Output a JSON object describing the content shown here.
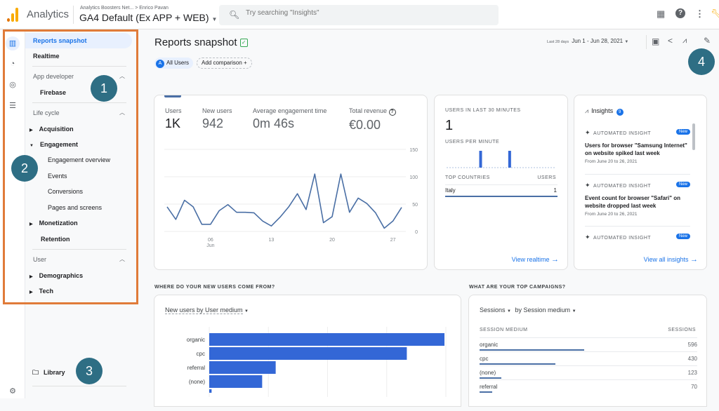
{
  "header": {
    "app_name": "Analytics",
    "breadcrumb_account": "Analytics Boosters Net...",
    "breadcrumb_sep": ">",
    "breadcrumb_user": "Enrico Pavan",
    "property": "GA4 Default (Ex APP + WEB)",
    "search_placeholder": "Try searching \"Insights\"",
    "logo_colors": [
      "#f9ab00",
      "#e37400"
    ]
  },
  "sidebar": {
    "items": [
      {
        "label": "Reports snapshot",
        "selected": true
      },
      {
        "label": "Realtime"
      },
      {
        "label": "App developer",
        "group": true
      },
      {
        "label": "Firebase"
      },
      {
        "label": "Life cycle",
        "group": true
      },
      {
        "label": "Acquisition"
      },
      {
        "label": "Engagement"
      },
      {
        "label": "Engagement overview"
      },
      {
        "label": "Events"
      },
      {
        "label": "Conversions"
      },
      {
        "label": "Pages and screens"
      },
      {
        "label": "Monetization"
      },
      {
        "label": "Retention"
      },
      {
        "label": "User",
        "group": true
      },
      {
        "label": "Demographics"
      },
      {
        "label": "Tech"
      }
    ],
    "library": "Library"
  },
  "annotations": [
    "1",
    "2",
    "3",
    "4"
  ],
  "page": {
    "title": "Reports snapshot",
    "date_prefix": "Last 28 days",
    "date_range": "Jun 1 - Jun 28, 2021",
    "segment_letter": "A",
    "segment": "All Users",
    "add_comparison": "Add comparison",
    "accent": "#1a73e8"
  },
  "kpis": [
    {
      "label": "Users",
      "value": "1K"
    },
    {
      "label": "New users",
      "value": "942"
    },
    {
      "label": "Average engagement time",
      "value": "0m 46s"
    },
    {
      "label": "Total revenue",
      "value": "€0.00"
    }
  ],
  "realtime": {
    "title": "USERS IN LAST 30 MINUTES",
    "value": "1",
    "per_minute_label": "USERS PER MINUTE",
    "countries_header": "TOP COUNTRIES",
    "users_header": "USERS",
    "rows": [
      {
        "country": "Italy",
        "users": "1"
      }
    ],
    "link": "View realtime"
  },
  "insights": {
    "title": "Insights",
    "count": "9",
    "items": [
      {
        "type": "AUTOMATED INSIGHT",
        "badge": "New",
        "text": "Users for browser \"Samsung Internet\" on website spiked last week",
        "date": "From June 20 to 26, 2021"
      },
      {
        "type": "AUTOMATED INSIGHT",
        "badge": "New",
        "text": "Event count for browser \"Safari\" on website dropped last week",
        "date": "From June 20 to 26, 2021"
      },
      {
        "type": "AUTOMATED INSIGHT",
        "badge": "New",
        "text": "",
        "date": ""
      }
    ],
    "link": "View all insights"
  },
  "new_users_section": {
    "heading": "WHERE DO YOUR NEW USERS COME FROM?",
    "selector": "New users by User medium"
  },
  "campaigns_section": {
    "heading": "WHAT ARE YOUR TOP CAMPAIGNS?",
    "metric_selector": "Sessions",
    "dimension_selector": "by Session medium",
    "col1": "SESSION MEDIUM",
    "col2": "SESSIONS",
    "rows": [
      {
        "medium": "organic",
        "sessions": 596
      },
      {
        "medium": "cpc",
        "sessions": 430
      },
      {
        "medium": "(none)",
        "sessions": 123
      },
      {
        "medium": "referral",
        "sessions": 70
      }
    ]
  },
  "chart_data": [
    {
      "type": "line",
      "title": "Users",
      "x": [
        1,
        2,
        3,
        4,
        5,
        6,
        7,
        8,
        9,
        10,
        11,
        12,
        13,
        14,
        15,
        16,
        17,
        18,
        19,
        20,
        21,
        22,
        23,
        24,
        25,
        26,
        27,
        28
      ],
      "x_tick_labels": [
        {
          "day": 6,
          "label": "06",
          "sub": "Jun"
        },
        {
          "day": 13,
          "label": "13"
        },
        {
          "day": 20,
          "label": "20"
        },
        {
          "day": 27,
          "label": "27"
        }
      ],
      "values": [
        45,
        22,
        57,
        45,
        13,
        13,
        38,
        49,
        35,
        35,
        34,
        19,
        10,
        26,
        45,
        69,
        40,
        105,
        16,
        27,
        105,
        35,
        61,
        51,
        34,
        6,
        19,
        44
      ],
      "ylim": [
        0,
        150
      ],
      "y_ticks": [
        0,
        50,
        100,
        150
      ],
      "grid": true,
      "color": "#4a6fa5"
    },
    {
      "type": "bar",
      "title": "Users per minute",
      "values": [
        0,
        0,
        0,
        0,
        0,
        0,
        0,
        0,
        0,
        1,
        0,
        0,
        0,
        0,
        0,
        0,
        0,
        1,
        0,
        0,
        0,
        0,
        0,
        0,
        0,
        0,
        0,
        0,
        0,
        0
      ],
      "color": "#3367d6"
    },
    {
      "type": "bar",
      "orientation": "horizontal",
      "title": "New users by User medium",
      "categories": [
        "organic",
        "cpc",
        "referral",
        "(none)",
        ""
      ],
      "values": [
        400,
        336,
        113,
        90,
        4
      ],
      "grid": true,
      "color": "#3367d6"
    }
  ]
}
